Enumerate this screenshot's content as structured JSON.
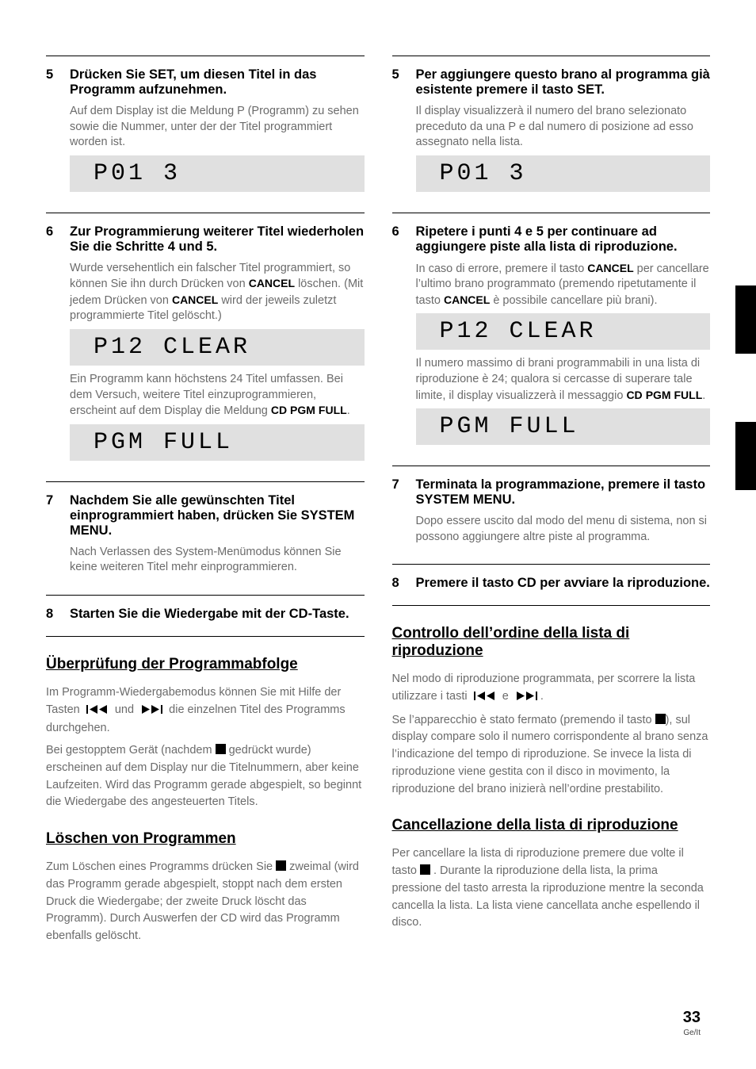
{
  "left": {
    "step5_text": "Drücken Sie SET, um diesen Titel in das Programm aufzunehmen.",
    "step5_note": "Auf dem Display ist die Meldung P (Programm) zu sehen sowie die Nummer, unter der der Titel programmiert worden ist.",
    "lcd1": "P01     3",
    "step6_text": "Zur Programmierung weiterer Titel wiederholen Sie die Schritte 4 und 5.",
    "step6_note1_a": "Wurde versehentlich ein falscher Titel programmiert, so können Sie ihn durch Drücken von ",
    "step6_note1_b": " löschen. (Mit jedem Drücken von ",
    "step6_note1_c": " wird der jeweils zuletzt programmierte Titel gelöscht.)",
    "cancel": "CANCEL",
    "lcd2": "P12 CLEAR",
    "step6_note2_a": "Ein Programm kann höchstens 24 Titel umfassen. Bei dem Versuch, weitere Titel einzuprogrammieren, erscheint auf dem Display die Meldung ",
    "step6_note2_b": ".",
    "cdpgm": "CD PGM",
    "full": "FULL",
    "lcd3": "PGM FULL",
    "step7_text": "Nachdem Sie alle gewünschten Titel einprogrammiert haben, drücken Sie SYSTEM MENU.",
    "step7_note": "Nach Verlassen des System-Menümodus können Sie keine weiteren Titel mehr einprogrammieren.",
    "step8_text": "Starten Sie die Wiedergabe mit der CD-Taste.",
    "h_check": "Überprüfung der Programmabfolge",
    "check_p1_a": "Im Programm-Wiedergabemodus können Sie mit Hilfe der Tasten ",
    "check_p1_b": " und ",
    "check_p1_c": " die einzelnen Titel des Programms durchgehen.",
    "check_p2_a": "Bei gestopptem Gerät (nachdem ",
    "check_p2_b": " gedrückt wurde) erscheinen auf dem Display nur die Titelnummern, aber keine Laufzeiten. Wird das Programm gerade abgespielt, so beginnt die Wiedergabe des angesteuerten Titels.",
    "h_del": "Löschen von Programmen",
    "del_p_a": "Zum Löschen eines Programms drücken Sie ",
    "del_p_b": " zweimal (wird das Programm gerade abgespielt, stoppt nach dem ersten Druck die Wiedergabe; der zweite Druck löscht das Programm). Durch Auswerfen der CD wird das Programm ebenfalls gelöscht."
  },
  "right": {
    "step5_text": "Per aggiungere questo brano al programma già esistente premere il tasto SET.",
    "step5_note": "Il display visualizzerà il numero del brano selezionato preceduto da una P e dal numero di posizione ad esso assegnato nella lista.",
    "lcd1": "P01     3",
    "step6_text": "Ripetere i punti 4 e 5 per continuare ad aggiungere piste alla lista di riproduzione.",
    "step6_note1_a": "In caso di errore, premere il tasto ",
    "step6_note1_b": " per cancellare l’ultimo brano programmato (premendo ripetutamente il tasto ",
    "step6_note1_c": " è possibile cancellare più brani).",
    "cancel": "CANCEL",
    "lcd2": "P12 CLEAR",
    "step6_note2_a": "Il numero massimo di brani programmabili in una lista di riproduzione è 24; qualora si cercasse di superare tale limite, il display visualizzerà il messaggio ",
    "step6_note2_b": ".",
    "cd": "CD",
    "pgmfull": "PGM FULL",
    "lcd3": "PGM FULL",
    "step7_text": "Terminata la programmazione, premere il tasto SYSTEM MENU.",
    "step7_note": "Dopo essere uscito dal modo del menu di sistema, non si possono aggiungere altre piste al programma.",
    "step8_text": "Premere il tasto CD per avviare la riproduzione.",
    "h_check": "Controllo dell’ordine della lista di riproduzione",
    "check_p1_a": "Nel modo di riproduzione programmata, per scorrere la lista utilizzare i tasti ",
    "check_p1_b": " e ",
    "check_p1_c": ".",
    "check_p2_a": "Se l’apparecchio è stato fermato (premendo il tasto ",
    "check_p2_b": "), sul display compare solo il numero corrispondente al brano senza l’indicazione del tempo di riproduzione. Se invece la lista di riproduzione viene gestita con il disco in movimento, la riproduzione del brano inizierà nell’ordine prestabilito.",
    "h_del": "Cancellazione della lista di riproduzione",
    "del_p_a": "Per cancellare la lista di riproduzione premere due volte il tasto ",
    "del_p_b": " . Durante la riproduzione della lista, la prima pressione del tasto arresta la riproduzione mentre la seconda cancella la lista. La lista viene cancellata anche espellendo il disco."
  },
  "pagenum": "33",
  "langcode": "Ge/It"
}
